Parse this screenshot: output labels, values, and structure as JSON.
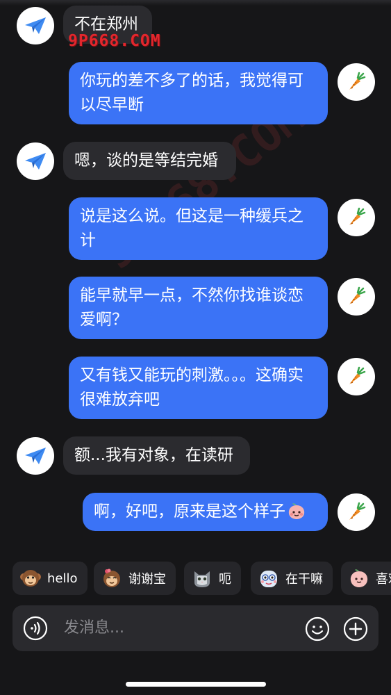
{
  "watermark": "9P668.COM",
  "messages": [
    {
      "side": "in",
      "text": "不在郑州"
    },
    {
      "side": "out",
      "text": "你玩的差不多了的话，我觉得可以尽早断"
    },
    {
      "side": "in",
      "text": "嗯，谈的是等结完婚"
    },
    {
      "side": "out",
      "text": "说是这么说。但这是一种缓兵之计"
    },
    {
      "side": "out",
      "text": "能早就早一点，不然你找谁谈恋爱啊？"
    },
    {
      "side": "out",
      "text": "又有钱又能玩的刺激。。。这确实很难放弃吧"
    },
    {
      "side": "in",
      "text": "额...我有对象，在读研"
    },
    {
      "side": "out",
      "text": "啊，好吧，原来是这个样子",
      "emoji": "peach-face-icon"
    }
  ],
  "quick_replies": [
    {
      "label": "hello",
      "emoji": "monkey-icon"
    },
    {
      "label": "谢谢宝",
      "emoji": "monkey-flower-icon"
    },
    {
      "label": "呃",
      "emoji": "cat-icon"
    },
    {
      "label": "在干嘛",
      "emoji": "cartoon-face-icon"
    },
    {
      "label": "喜欢",
      "emoji": "peach-character-icon"
    }
  ],
  "composer": {
    "placeholder": "发消息..."
  },
  "colors": {
    "background": "#161618",
    "outgoing_bubble": "#3b73f6",
    "incoming_bubble": "#2b2b2f"
  },
  "avatars": {
    "contact": "paper-plane-icon",
    "self": "carrot-icon"
  }
}
